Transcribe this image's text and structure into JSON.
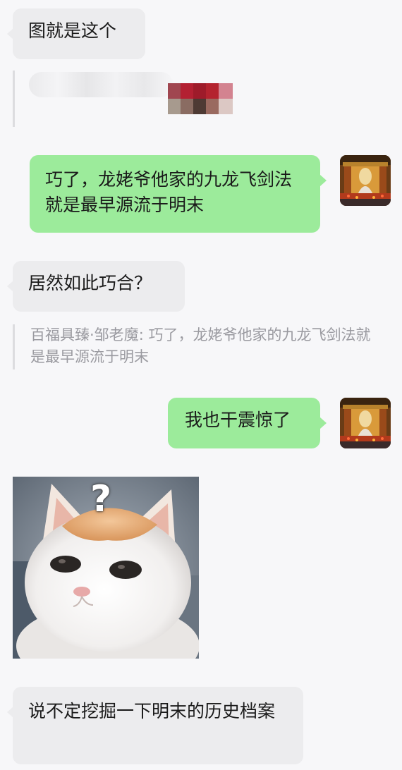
{
  "messages": {
    "m1": {
      "text": "图就是这个"
    },
    "m3": {
      "text": "巧了，龙姥爷他家的九龙飞剑法就是最早源流于明末"
    },
    "m4": {
      "text": "居然如此巧合？"
    },
    "m4_quote": {
      "sender": "百福具臻·邹老魔",
      "separator": ": ",
      "text": "巧了，龙姥爷他家的九龙飞剑法就是最早源流于明末"
    },
    "m5": {
      "text": "我也干震惊了"
    },
    "m6": {
      "image_overlay": "?"
    },
    "m7": {
      "text": "说不定挖掘一下明末的历史档案"
    }
  },
  "colors": {
    "background": "#f7f7f9",
    "incoming_bubble": "#ececee",
    "outgoing_bubble": "#9ceb9b",
    "quote_text": "#9a9aa0"
  },
  "icons": {
    "avatar": "temple-avatar-image",
    "pixelated_quote": "pixelated-redacted-image"
  }
}
